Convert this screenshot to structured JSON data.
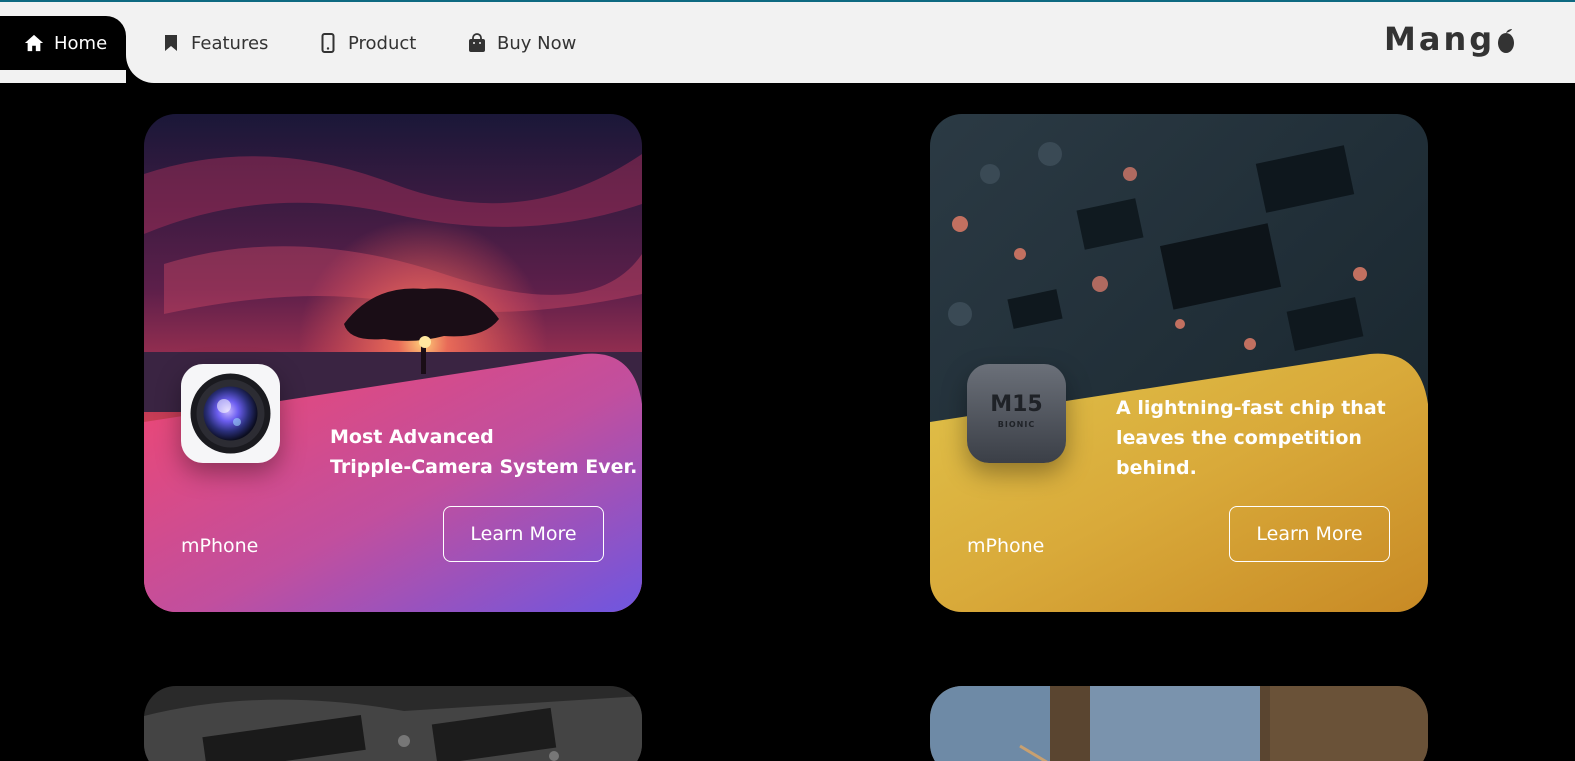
{
  "nav": {
    "items": [
      {
        "label": "Home",
        "icon": "home-icon"
      },
      {
        "label": "Features",
        "icon": "bookmark-icon"
      },
      {
        "label": "Product",
        "icon": "phone-icon"
      },
      {
        "label": "Buy Now",
        "icon": "shopping-bag-icon"
      }
    ],
    "logo": "Mang"
  },
  "cards": [
    {
      "headline_1": "Most Advanced",
      "headline_2": "Tripple-Camera System Ever.",
      "brand": "mPhone",
      "button": "Learn More",
      "icon": "camera-lens-icon",
      "colors": {
        "gradient_start": "#f2466f",
        "gradient_end": "#6e56e0"
      }
    },
    {
      "headline_1": "A lightning-fast chip that",
      "headline_2": "leaves the competition",
      "headline_3": "behind.",
      "brand": "mPhone",
      "button": "Learn More",
      "icon": "chip-icon",
      "chip_label": "M15",
      "chip_sub": "BIONIC",
      "colors": {
        "gradient_start": "#e0c24a",
        "gradient_end": "#c88a25"
      }
    }
  ],
  "colors": {
    "top_line": "#0e6a82",
    "nav_bg": "#f2f2f2",
    "page_bg": "#000000"
  }
}
